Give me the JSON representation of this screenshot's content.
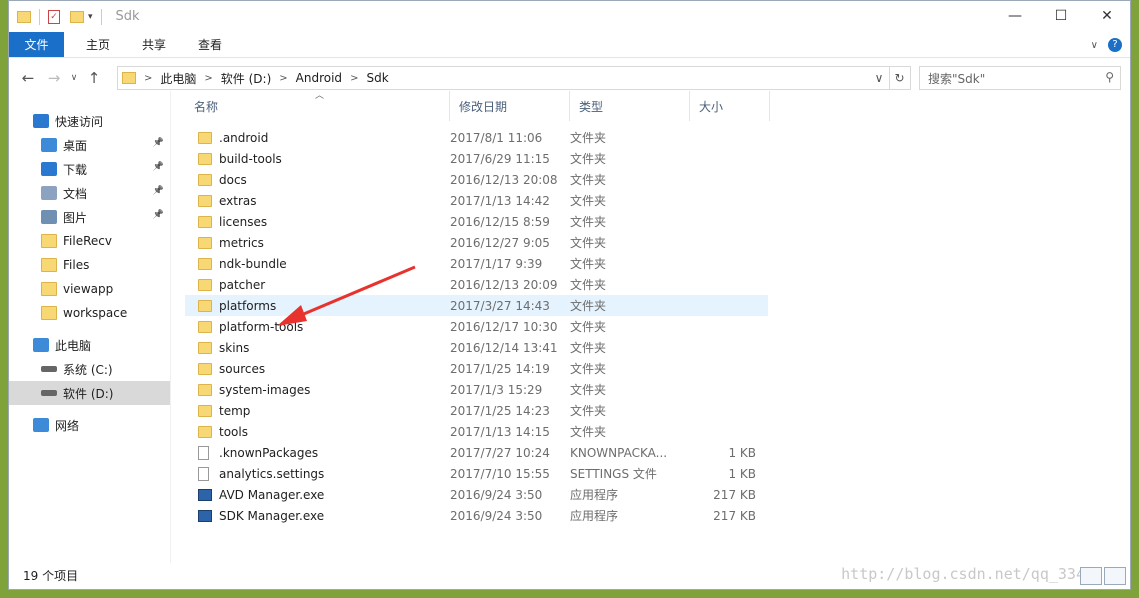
{
  "window": {
    "title": "Sdk",
    "controls": [
      "—",
      "☐",
      "✕"
    ]
  },
  "ribbon": {
    "tabs": [
      "文件",
      "主页",
      "共享",
      "查看"
    ]
  },
  "address": {
    "crumbs": [
      "此电脑",
      "软件 (D:)",
      "Android",
      "Sdk"
    ],
    "search_placeholder": "搜索\"Sdk\""
  },
  "nav": {
    "items": [
      {
        "label": "快速访问",
        "icon": "star-icon",
        "pinned": false,
        "level": 0
      },
      {
        "label": "桌面",
        "icon": "desktop-icon",
        "pinned": true,
        "level": 1
      },
      {
        "label": "下载",
        "icon": "download-icon",
        "pinned": true,
        "level": 1
      },
      {
        "label": "文档",
        "icon": "document-icon",
        "pinned": true,
        "level": 1
      },
      {
        "label": "图片",
        "icon": "pictures-icon",
        "pinned": true,
        "level": 1
      },
      {
        "label": "FileRecv",
        "icon": "folder-icon",
        "pinned": false,
        "level": 1
      },
      {
        "label": "Files",
        "icon": "folder-icon",
        "pinned": false,
        "level": 1
      },
      {
        "label": "viewapp",
        "icon": "folder-icon",
        "pinned": false,
        "level": 1
      },
      {
        "label": "workspace",
        "icon": "folder-icon",
        "pinned": false,
        "level": 1
      },
      {
        "label": "此电脑",
        "icon": "computer-icon",
        "pinned": false,
        "level": 0
      },
      {
        "label": "系统 (C:)",
        "icon": "drive-icon",
        "pinned": false,
        "level": 1
      },
      {
        "label": "软件 (D:)",
        "icon": "drive-icon",
        "pinned": false,
        "level": 1,
        "selected": true
      },
      {
        "label": "网络",
        "icon": "network-icon",
        "pinned": false,
        "level": 0
      }
    ]
  },
  "list": {
    "columns": [
      "名称",
      "修改日期",
      "类型",
      "大小"
    ],
    "files": [
      {
        "name": ".android",
        "date": "2017/8/1 11:06",
        "type": "文件夹",
        "size": "",
        "icon": "folder-icon"
      },
      {
        "name": "build-tools",
        "date": "2017/6/29 11:15",
        "type": "文件夹",
        "size": "",
        "icon": "folder-icon"
      },
      {
        "name": "docs",
        "date": "2016/12/13 20:08",
        "type": "文件夹",
        "size": "",
        "icon": "folder-icon"
      },
      {
        "name": "extras",
        "date": "2017/1/13 14:42",
        "type": "文件夹",
        "size": "",
        "icon": "folder-icon"
      },
      {
        "name": "licenses",
        "date": "2016/12/15 8:59",
        "type": "文件夹",
        "size": "",
        "icon": "folder-icon"
      },
      {
        "name": "metrics",
        "date": "2016/12/27 9:05",
        "type": "文件夹",
        "size": "",
        "icon": "folder-icon"
      },
      {
        "name": "ndk-bundle",
        "date": "2017/1/17 9:39",
        "type": "文件夹",
        "size": "",
        "icon": "folder-icon"
      },
      {
        "name": "patcher",
        "date": "2016/12/13 20:09",
        "type": "文件夹",
        "size": "",
        "icon": "folder-icon"
      },
      {
        "name": "platforms",
        "date": "2017/3/27 14:43",
        "type": "文件夹",
        "size": "",
        "icon": "folder-icon",
        "highlighted": true
      },
      {
        "name": "platform-tools",
        "date": "2016/12/17 10:30",
        "type": "文件夹",
        "size": "",
        "icon": "folder-icon"
      },
      {
        "name": "skins",
        "date": "2016/12/14 13:41",
        "type": "文件夹",
        "size": "",
        "icon": "folder-icon"
      },
      {
        "name": "sources",
        "date": "2017/1/25 14:19",
        "type": "文件夹",
        "size": "",
        "icon": "folder-icon"
      },
      {
        "name": "system-images",
        "date": "2017/1/3 15:29",
        "type": "文件夹",
        "size": "",
        "icon": "folder-icon"
      },
      {
        "name": "temp",
        "date": "2017/1/25 14:23",
        "type": "文件夹",
        "size": "",
        "icon": "folder-icon"
      },
      {
        "name": "tools",
        "date": "2017/1/13 14:15",
        "type": "文件夹",
        "size": "",
        "icon": "folder-icon"
      },
      {
        "name": ".knownPackages",
        "date": "2017/7/27 10:24",
        "type": "KNOWNPACKA...",
        "size": "1 KB",
        "icon": "file-icon"
      },
      {
        "name": "analytics.settings",
        "date": "2017/7/10 15:55",
        "type": "SETTINGS 文件",
        "size": "1 KB",
        "icon": "file-icon"
      },
      {
        "name": "AVD Manager.exe",
        "date": "2016/9/24 3:50",
        "type": "应用程序",
        "size": "217 KB",
        "icon": "exe-icon"
      },
      {
        "name": "SDK Manager.exe",
        "date": "2016/9/24 3:50",
        "type": "应用程序",
        "size": "217 KB",
        "icon": "exe-icon"
      }
    ]
  },
  "status": {
    "count": "19 个项目"
  },
  "watermark": "http://blog.csdn.net/qq_334",
  "colors": {
    "accent": "#1a6fc9",
    "folder": "#f8d775",
    "highlight": "#e5f3ff",
    "annotation": "#e8322d"
  }
}
